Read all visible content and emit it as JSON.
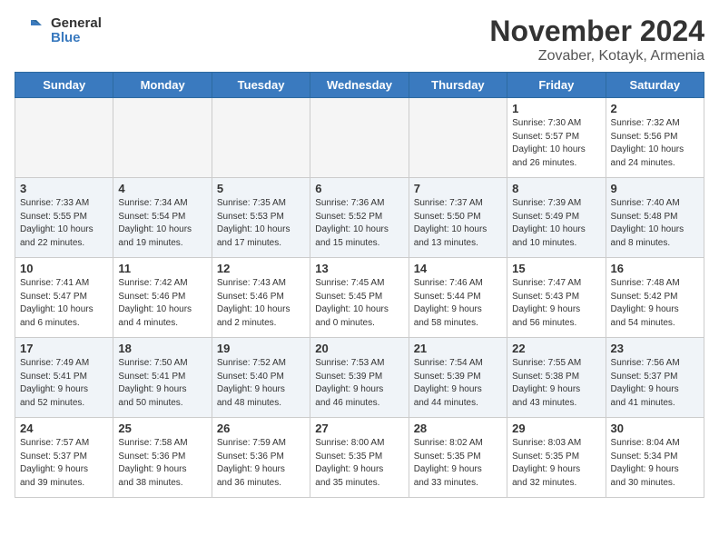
{
  "header": {
    "logo_line1": "General",
    "logo_line2": "Blue",
    "month_title": "November 2024",
    "subtitle": "Zovaber, Kotayk, Armenia"
  },
  "weekdays": [
    "Sunday",
    "Monday",
    "Tuesday",
    "Wednesday",
    "Thursday",
    "Friday",
    "Saturday"
  ],
  "weeks": [
    [
      {
        "day": "",
        "detail": "",
        "empty": true
      },
      {
        "day": "",
        "detail": "",
        "empty": true
      },
      {
        "day": "",
        "detail": "",
        "empty": true
      },
      {
        "day": "",
        "detail": "",
        "empty": true
      },
      {
        "day": "",
        "detail": "",
        "empty": true
      },
      {
        "day": "1",
        "detail": "Sunrise: 7:30 AM\nSunset: 5:57 PM\nDaylight: 10 hours\nand 26 minutes."
      },
      {
        "day": "2",
        "detail": "Sunrise: 7:32 AM\nSunset: 5:56 PM\nDaylight: 10 hours\nand 24 minutes."
      }
    ],
    [
      {
        "day": "3",
        "detail": "Sunrise: 7:33 AM\nSunset: 5:55 PM\nDaylight: 10 hours\nand 22 minutes."
      },
      {
        "day": "4",
        "detail": "Sunrise: 7:34 AM\nSunset: 5:54 PM\nDaylight: 10 hours\nand 19 minutes."
      },
      {
        "day": "5",
        "detail": "Sunrise: 7:35 AM\nSunset: 5:53 PM\nDaylight: 10 hours\nand 17 minutes."
      },
      {
        "day": "6",
        "detail": "Sunrise: 7:36 AM\nSunset: 5:52 PM\nDaylight: 10 hours\nand 15 minutes."
      },
      {
        "day": "7",
        "detail": "Sunrise: 7:37 AM\nSunset: 5:50 PM\nDaylight: 10 hours\nand 13 minutes."
      },
      {
        "day": "8",
        "detail": "Sunrise: 7:39 AM\nSunset: 5:49 PM\nDaylight: 10 hours\nand 10 minutes."
      },
      {
        "day": "9",
        "detail": "Sunrise: 7:40 AM\nSunset: 5:48 PM\nDaylight: 10 hours\nand 8 minutes."
      }
    ],
    [
      {
        "day": "10",
        "detail": "Sunrise: 7:41 AM\nSunset: 5:47 PM\nDaylight: 10 hours\nand 6 minutes."
      },
      {
        "day": "11",
        "detail": "Sunrise: 7:42 AM\nSunset: 5:46 PM\nDaylight: 10 hours\nand 4 minutes."
      },
      {
        "day": "12",
        "detail": "Sunrise: 7:43 AM\nSunset: 5:46 PM\nDaylight: 10 hours\nand 2 minutes."
      },
      {
        "day": "13",
        "detail": "Sunrise: 7:45 AM\nSunset: 5:45 PM\nDaylight: 10 hours\nand 0 minutes."
      },
      {
        "day": "14",
        "detail": "Sunrise: 7:46 AM\nSunset: 5:44 PM\nDaylight: 9 hours\nand 58 minutes."
      },
      {
        "day": "15",
        "detail": "Sunrise: 7:47 AM\nSunset: 5:43 PM\nDaylight: 9 hours\nand 56 minutes."
      },
      {
        "day": "16",
        "detail": "Sunrise: 7:48 AM\nSunset: 5:42 PM\nDaylight: 9 hours\nand 54 minutes."
      }
    ],
    [
      {
        "day": "17",
        "detail": "Sunrise: 7:49 AM\nSunset: 5:41 PM\nDaylight: 9 hours\nand 52 minutes."
      },
      {
        "day": "18",
        "detail": "Sunrise: 7:50 AM\nSunset: 5:41 PM\nDaylight: 9 hours\nand 50 minutes."
      },
      {
        "day": "19",
        "detail": "Sunrise: 7:52 AM\nSunset: 5:40 PM\nDaylight: 9 hours\nand 48 minutes."
      },
      {
        "day": "20",
        "detail": "Sunrise: 7:53 AM\nSunset: 5:39 PM\nDaylight: 9 hours\nand 46 minutes."
      },
      {
        "day": "21",
        "detail": "Sunrise: 7:54 AM\nSunset: 5:39 PM\nDaylight: 9 hours\nand 44 minutes."
      },
      {
        "day": "22",
        "detail": "Sunrise: 7:55 AM\nSunset: 5:38 PM\nDaylight: 9 hours\nand 43 minutes."
      },
      {
        "day": "23",
        "detail": "Sunrise: 7:56 AM\nSunset: 5:37 PM\nDaylight: 9 hours\nand 41 minutes."
      }
    ],
    [
      {
        "day": "24",
        "detail": "Sunrise: 7:57 AM\nSunset: 5:37 PM\nDaylight: 9 hours\nand 39 minutes."
      },
      {
        "day": "25",
        "detail": "Sunrise: 7:58 AM\nSunset: 5:36 PM\nDaylight: 9 hours\nand 38 minutes."
      },
      {
        "day": "26",
        "detail": "Sunrise: 7:59 AM\nSunset: 5:36 PM\nDaylight: 9 hours\nand 36 minutes."
      },
      {
        "day": "27",
        "detail": "Sunrise: 8:00 AM\nSunset: 5:35 PM\nDaylight: 9 hours\nand 35 minutes."
      },
      {
        "day": "28",
        "detail": "Sunrise: 8:02 AM\nSunset: 5:35 PM\nDaylight: 9 hours\nand 33 minutes."
      },
      {
        "day": "29",
        "detail": "Sunrise: 8:03 AM\nSunset: 5:35 PM\nDaylight: 9 hours\nand 32 minutes."
      },
      {
        "day": "30",
        "detail": "Sunrise: 8:04 AM\nSunset: 5:34 PM\nDaylight: 9 hours\nand 30 minutes."
      }
    ]
  ]
}
